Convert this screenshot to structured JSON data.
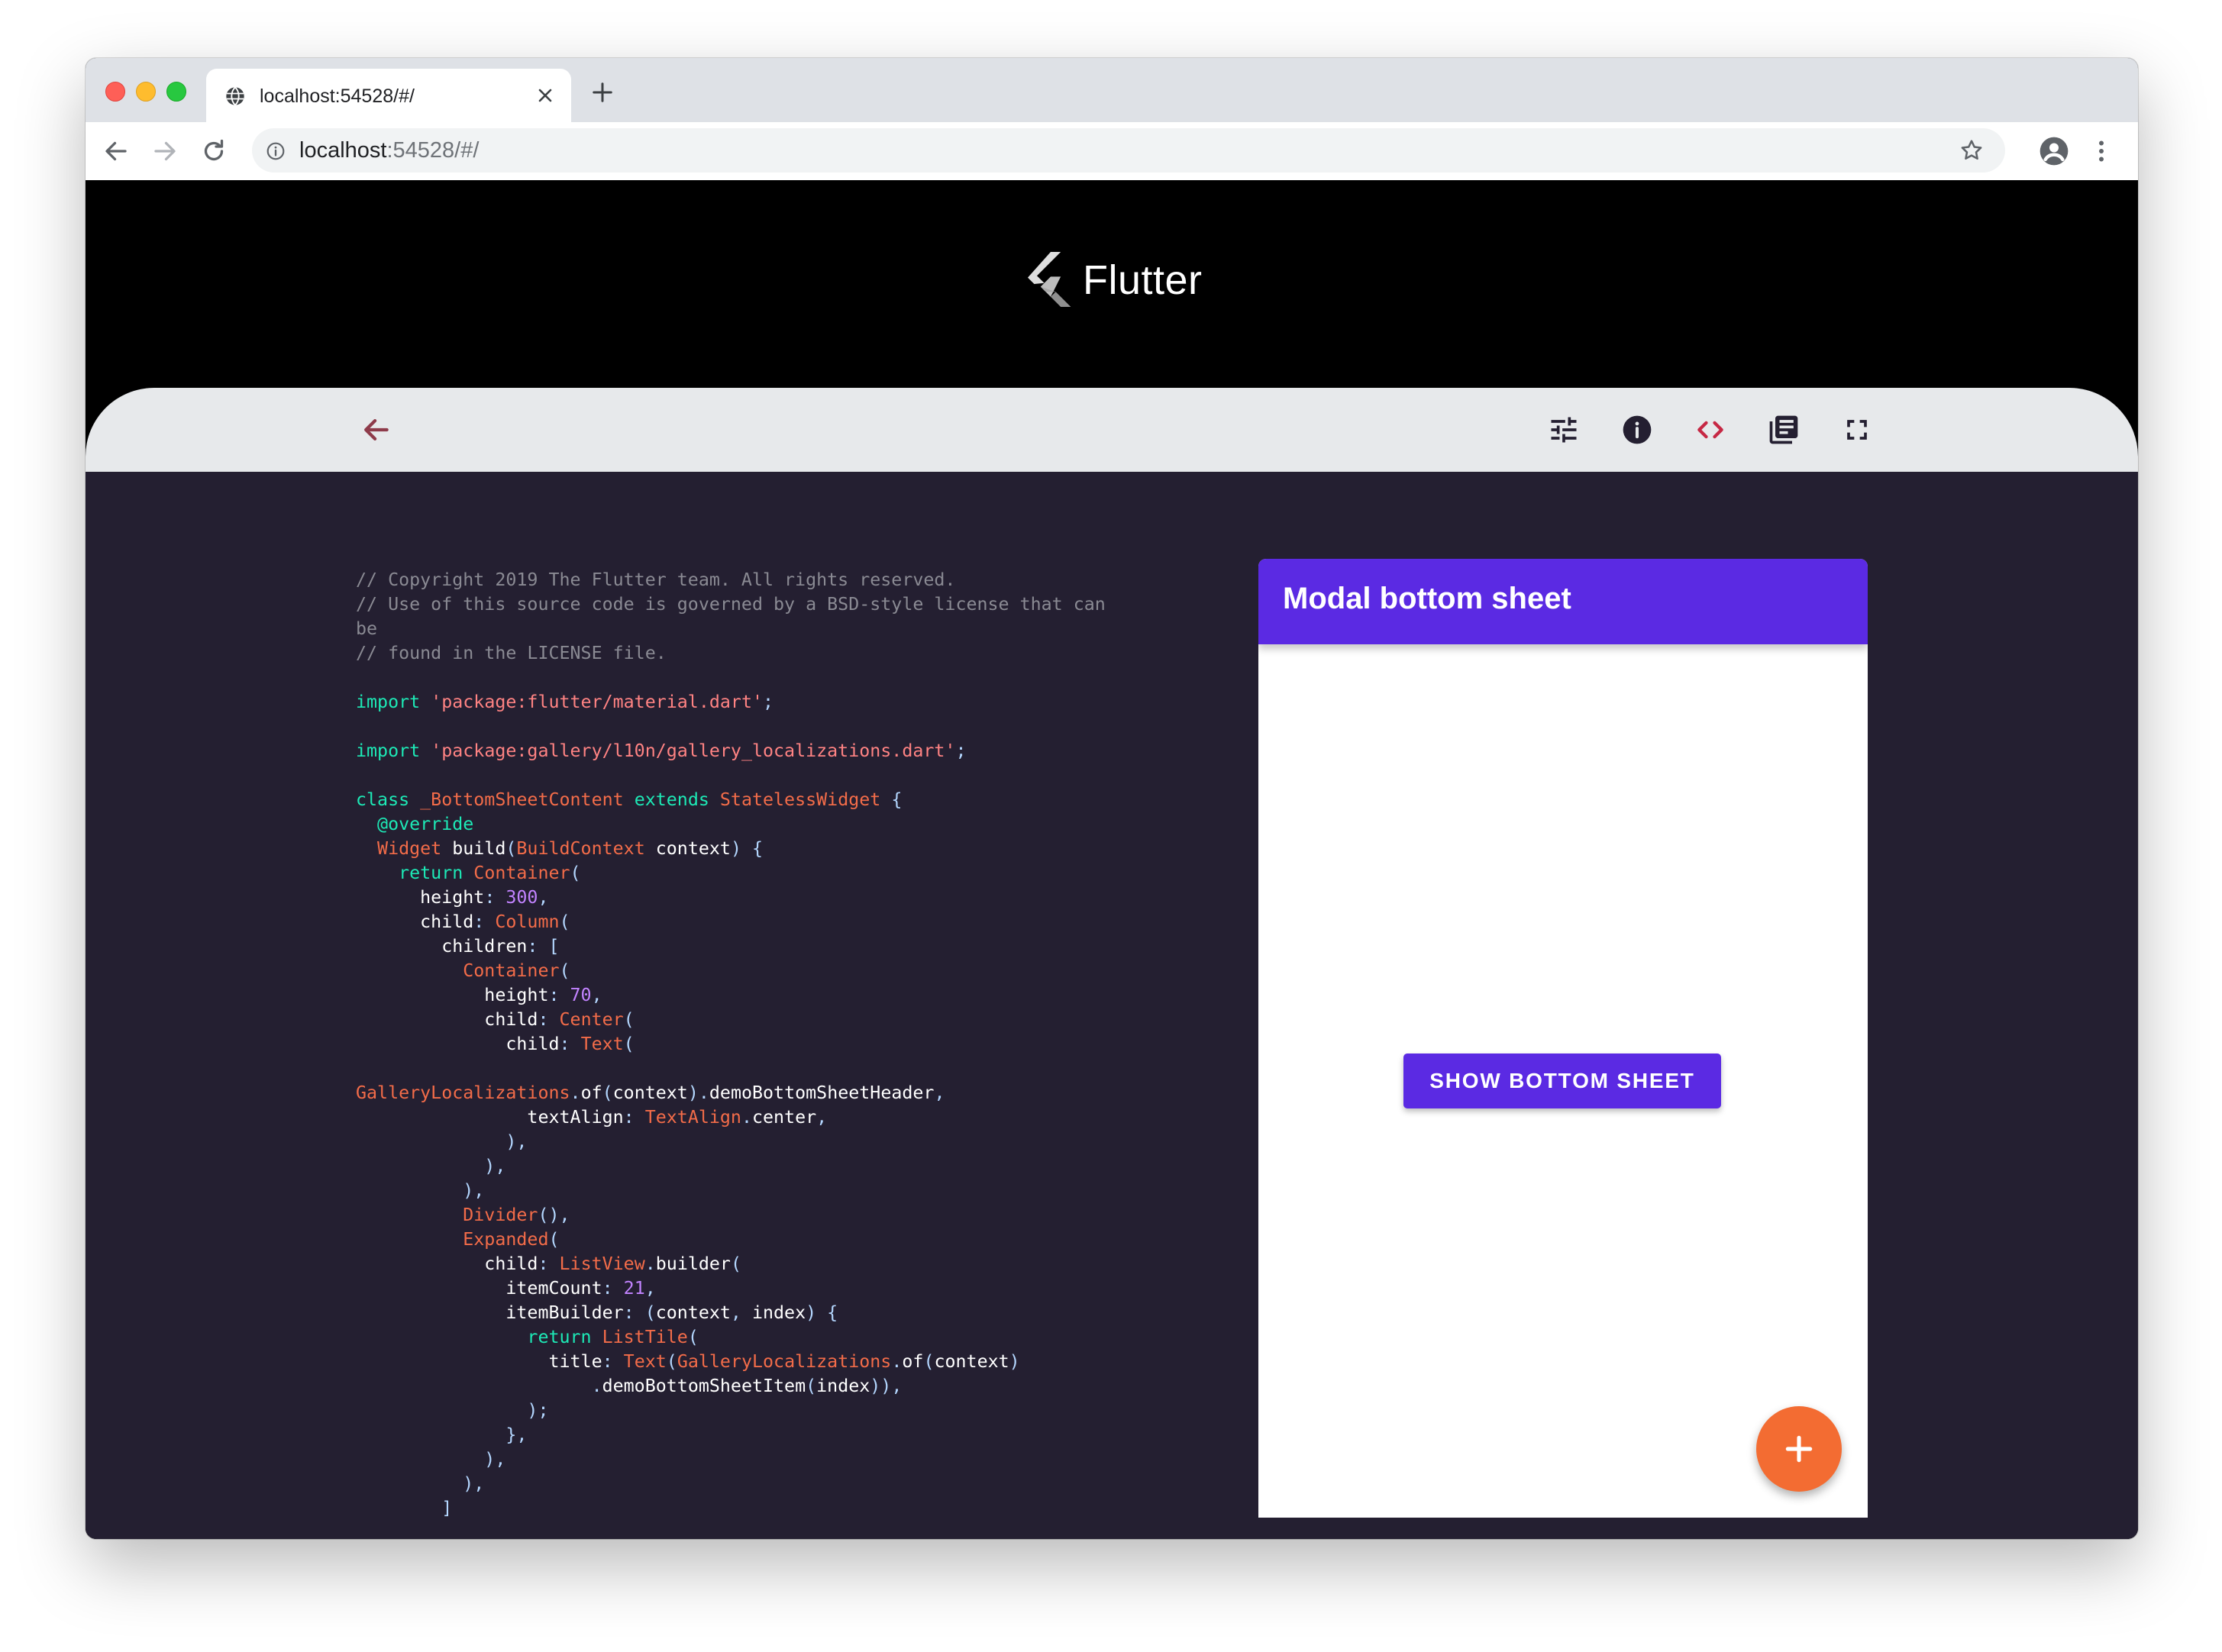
{
  "browser": {
    "tab_title": "localhost:54528/#/",
    "url_host": "localhost",
    "url_rest": ":54528/#/"
  },
  "banner": {
    "logo_text": "Flutter"
  },
  "demo": {
    "app_title": "Modal bottom sheet",
    "show_button_label": "SHOW BOTTOM SHEET",
    "accent_color": "#5b2ae3",
    "fab_color": "#f36c32"
  },
  "icons": {
    "back": "arrow-back-icon",
    "options": "tune-icon",
    "info": "info-icon",
    "code": "code-icon",
    "documentation": "library-books-icon",
    "fullscreen": "fullscreen-icon",
    "fab": "add-icon"
  },
  "code_lines": [
    [
      [
        "com",
        "// Copyright 2019 The Flutter team. All rights reserved."
      ]
    ],
    [
      [
        "com",
        "// Use of this source code is governed by a BSD-style license that can"
      ]
    ],
    [
      [
        "com",
        "be"
      ]
    ],
    [
      [
        "com",
        "// found in the LICENSE file."
      ]
    ],
    [],
    [
      [
        "kw",
        "import "
      ],
      [
        "str",
        "'package:flutter/material.dart'"
      ],
      [
        "p",
        ";"
      ]
    ],
    [],
    [
      [
        "kw",
        "import "
      ],
      [
        "str",
        "'package:gallery/l10n/gallery_localizations.dart'"
      ],
      [
        "p",
        ";"
      ]
    ],
    [],
    [
      [
        "kw",
        "class "
      ],
      [
        "cls",
        "_BottomSheetContent "
      ],
      [
        "kw",
        "extends "
      ],
      [
        "cls",
        "StatelessWidget "
      ],
      [
        "p",
        "{"
      ]
    ],
    [
      [
        "kw",
        "  @override"
      ]
    ],
    [
      [
        "cls",
        "  Widget "
      ],
      [
        "id",
        "build"
      ],
      [
        "p",
        "("
      ],
      [
        "cls",
        "BuildContext "
      ],
      [
        "id",
        "context"
      ],
      [
        "p",
        ") {"
      ]
    ],
    [
      [
        "kw",
        "    return "
      ],
      [
        "cls",
        "Container"
      ],
      [
        "p",
        "("
      ]
    ],
    [
      [
        "id",
        "      height"
      ],
      [
        "p",
        ": "
      ],
      [
        "num",
        "300"
      ],
      [
        "p",
        ","
      ]
    ],
    [
      [
        "id",
        "      child"
      ],
      [
        "p",
        ": "
      ],
      [
        "cls",
        "Column"
      ],
      [
        "p",
        "("
      ]
    ],
    [
      [
        "id",
        "        children"
      ],
      [
        "p",
        ": ["
      ]
    ],
    [
      [
        "cls",
        "          Container"
      ],
      [
        "p",
        "("
      ]
    ],
    [
      [
        "id",
        "            height"
      ],
      [
        "p",
        ": "
      ],
      [
        "num",
        "70"
      ],
      [
        "p",
        ","
      ]
    ],
    [
      [
        "id",
        "            child"
      ],
      [
        "p",
        ": "
      ],
      [
        "cls",
        "Center"
      ],
      [
        "p",
        "("
      ]
    ],
    [
      [
        "id",
        "              child"
      ],
      [
        "p",
        ": "
      ],
      [
        "cls",
        "Text"
      ],
      [
        "p",
        "("
      ]
    ],
    [],
    [
      [
        "cls",
        "GalleryLocalizations"
      ],
      [
        "p",
        "."
      ],
      [
        "id",
        "of"
      ],
      [
        "p",
        "("
      ],
      [
        "id",
        "context"
      ],
      [
        "p",
        ")."
      ],
      [
        "id",
        "demoBottomSheetHeader"
      ],
      [
        "p",
        ","
      ]
    ],
    [
      [
        "id",
        "                textAlign"
      ],
      [
        "p",
        ": "
      ],
      [
        "cls",
        "TextAlign"
      ],
      [
        "p",
        "."
      ],
      [
        "id",
        "center"
      ],
      [
        "p",
        ","
      ]
    ],
    [
      [
        "p",
        "              ),"
      ]
    ],
    [
      [
        "p",
        "            ),"
      ]
    ],
    [
      [
        "p",
        "          ),"
      ]
    ],
    [
      [
        "cls",
        "          Divider"
      ],
      [
        "p",
        "(),"
      ]
    ],
    [
      [
        "cls",
        "          Expanded"
      ],
      [
        "p",
        "("
      ]
    ],
    [
      [
        "id",
        "            child"
      ],
      [
        "p",
        ": "
      ],
      [
        "cls",
        "ListView"
      ],
      [
        "p",
        "."
      ],
      [
        "id",
        "builder"
      ],
      [
        "p",
        "("
      ]
    ],
    [
      [
        "id",
        "              itemCount"
      ],
      [
        "p",
        ": "
      ],
      [
        "num",
        "21"
      ],
      [
        "p",
        ","
      ]
    ],
    [
      [
        "id",
        "              itemBuilder"
      ],
      [
        "p",
        ": ("
      ],
      [
        "id",
        "context"
      ],
      [
        "p",
        ", "
      ],
      [
        "id",
        "index"
      ],
      [
        "p",
        ") {"
      ]
    ],
    [
      [
        "kw",
        "                return "
      ],
      [
        "cls",
        "ListTile"
      ],
      [
        "p",
        "("
      ]
    ],
    [
      [
        "id",
        "                  title"
      ],
      [
        "p",
        ": "
      ],
      [
        "cls",
        "Text"
      ],
      [
        "p",
        "("
      ],
      [
        "cls",
        "GalleryLocalizations"
      ],
      [
        "p",
        "."
      ],
      [
        "id",
        "of"
      ],
      [
        "p",
        "("
      ],
      [
        "id",
        "context"
      ],
      [
        "p",
        ")"
      ]
    ],
    [
      [
        "p",
        "                      ."
      ],
      [
        "id",
        "demoBottomSheetItem"
      ],
      [
        "p",
        "("
      ],
      [
        "id",
        "index"
      ],
      [
        "p",
        ")),"
      ]
    ],
    [
      [
        "p",
        "                );"
      ]
    ],
    [
      [
        "p",
        "              },"
      ]
    ],
    [
      [
        "p",
        "            ),"
      ]
    ],
    [
      [
        "p",
        "          ),"
      ]
    ],
    [
      [
        "p",
        "        ]"
      ]
    ]
  ]
}
